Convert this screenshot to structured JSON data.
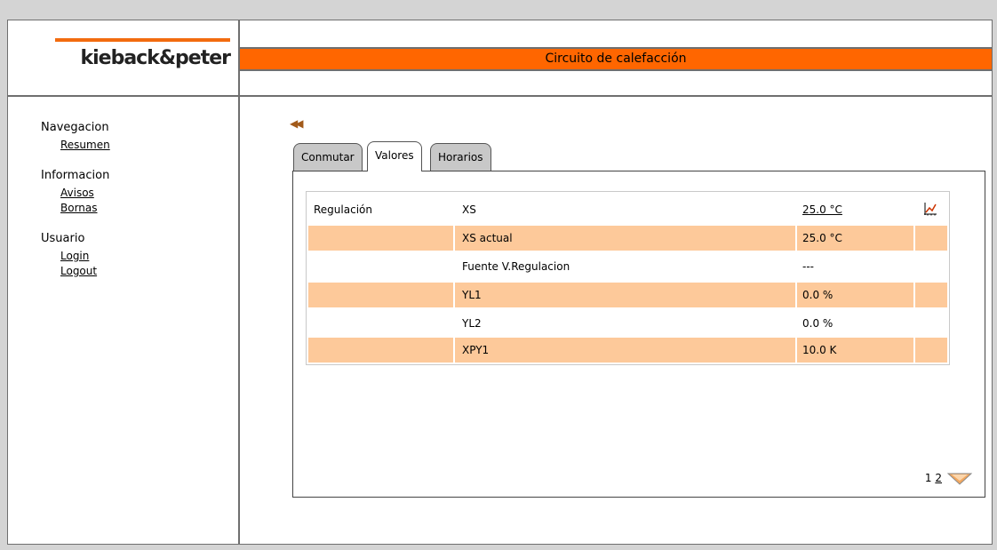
{
  "brand": {
    "logo_text": "kieback&peter",
    "accent": "#ff6600"
  },
  "header": {
    "title": "Circuito de calefacción"
  },
  "nav": {
    "groups": [
      {
        "heading": "Navegacion",
        "links": [
          "Resumen"
        ]
      },
      {
        "heading": "Informacion",
        "links": [
          "Avisos",
          "Bornas"
        ]
      },
      {
        "heading": "Usuario",
        "links": [
          "Login",
          "Logout"
        ]
      }
    ]
  },
  "back_icon": "rewind-icon",
  "tabs": [
    {
      "label": "Conmutar",
      "active": false
    },
    {
      "label": "Valores",
      "active": true
    },
    {
      "label": "Horarios",
      "active": false
    }
  ],
  "table": {
    "rows": [
      {
        "group": "Regulación",
        "name": "XS",
        "value": "25.0 °C",
        "link": true,
        "trend": "trend-chart-icon"
      },
      {
        "group": "",
        "name": "XS actual",
        "value": "25.0 °C",
        "link": false
      },
      {
        "group": "",
        "name": "Fuente V.Regulacion",
        "value": "---",
        "link": false
      },
      {
        "group": "",
        "name": "YL1",
        "value": "0.0 %",
        "link": false
      },
      {
        "group": "",
        "name": "YL2",
        "value": "0.0 %",
        "link": false
      },
      {
        "group": "",
        "name": "XPY1",
        "value": "10.0 K",
        "link": false
      }
    ]
  },
  "pager": {
    "current": "1",
    "next": "2",
    "arrow_icon": "chevron-down-icon"
  }
}
